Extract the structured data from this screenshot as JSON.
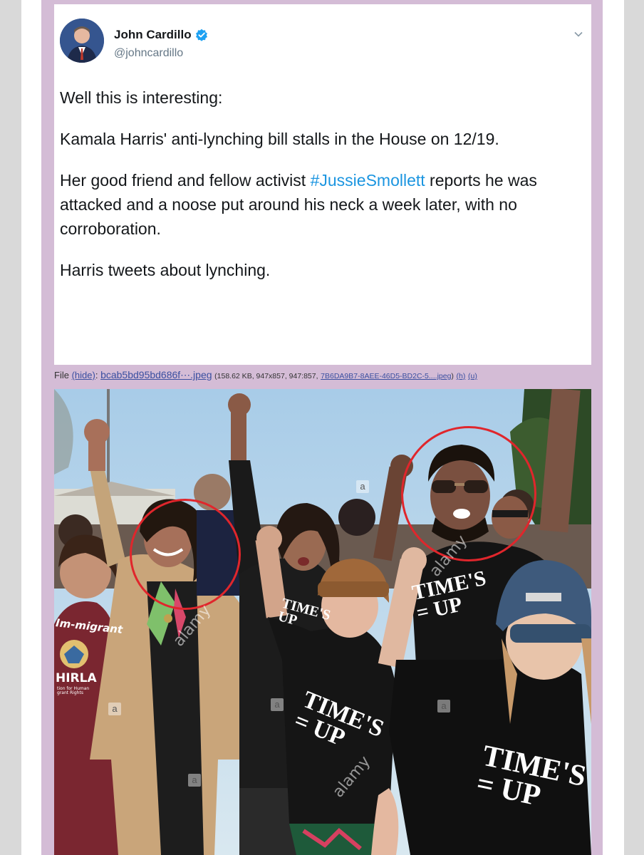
{
  "tweet": {
    "display_name": "John Cardillo",
    "handle": "@johncardillo",
    "verified_icon": "verified-badge-icon",
    "menu_icon": "chevron-down-icon",
    "paragraphs": {
      "p1": "Well this is interesting:",
      "p2": "Kamala Harris' anti-lynching bill stalls in the House on 12/19.",
      "p3_before": "Her good friend and fellow activist ",
      "p3_hashtag": "#JussieSmollett",
      "p3_after": " reports he was attacked and a noose put around his neck a week later, with no corroboration.",
      "p4": "Harris tweets about lynching."
    },
    "hashtag_color": "#1b95e0"
  },
  "file_info": {
    "label": "File",
    "hide_link": "(hide)",
    "filename_link": "bcab5bd95bd686f⋯.jpeg",
    "meta": "(158.62 KB, 947x857, 947:857,",
    "original_link": "7B6DA9B7-8AEE-46D5-BD2C-5....jpeg",
    "meta_close": ")",
    "h_link": "(h)",
    "u_link": "(u)"
  },
  "photo": {
    "shirt_texts": {
      "left_kid": "TIME'S\n= UP",
      "front_right_kid": "TIME'S\n= UP",
      "jussie": "TIME'S\n= UP",
      "middle": "TIME'S\nUP"
    },
    "sign_text": "Im-migrant",
    "sign_sub": "HIRLA",
    "sign_small": "tion for Human\ngrant Rights",
    "watermark": "alamy",
    "watermark_a": "a",
    "highlight_color": "#e0262c"
  }
}
